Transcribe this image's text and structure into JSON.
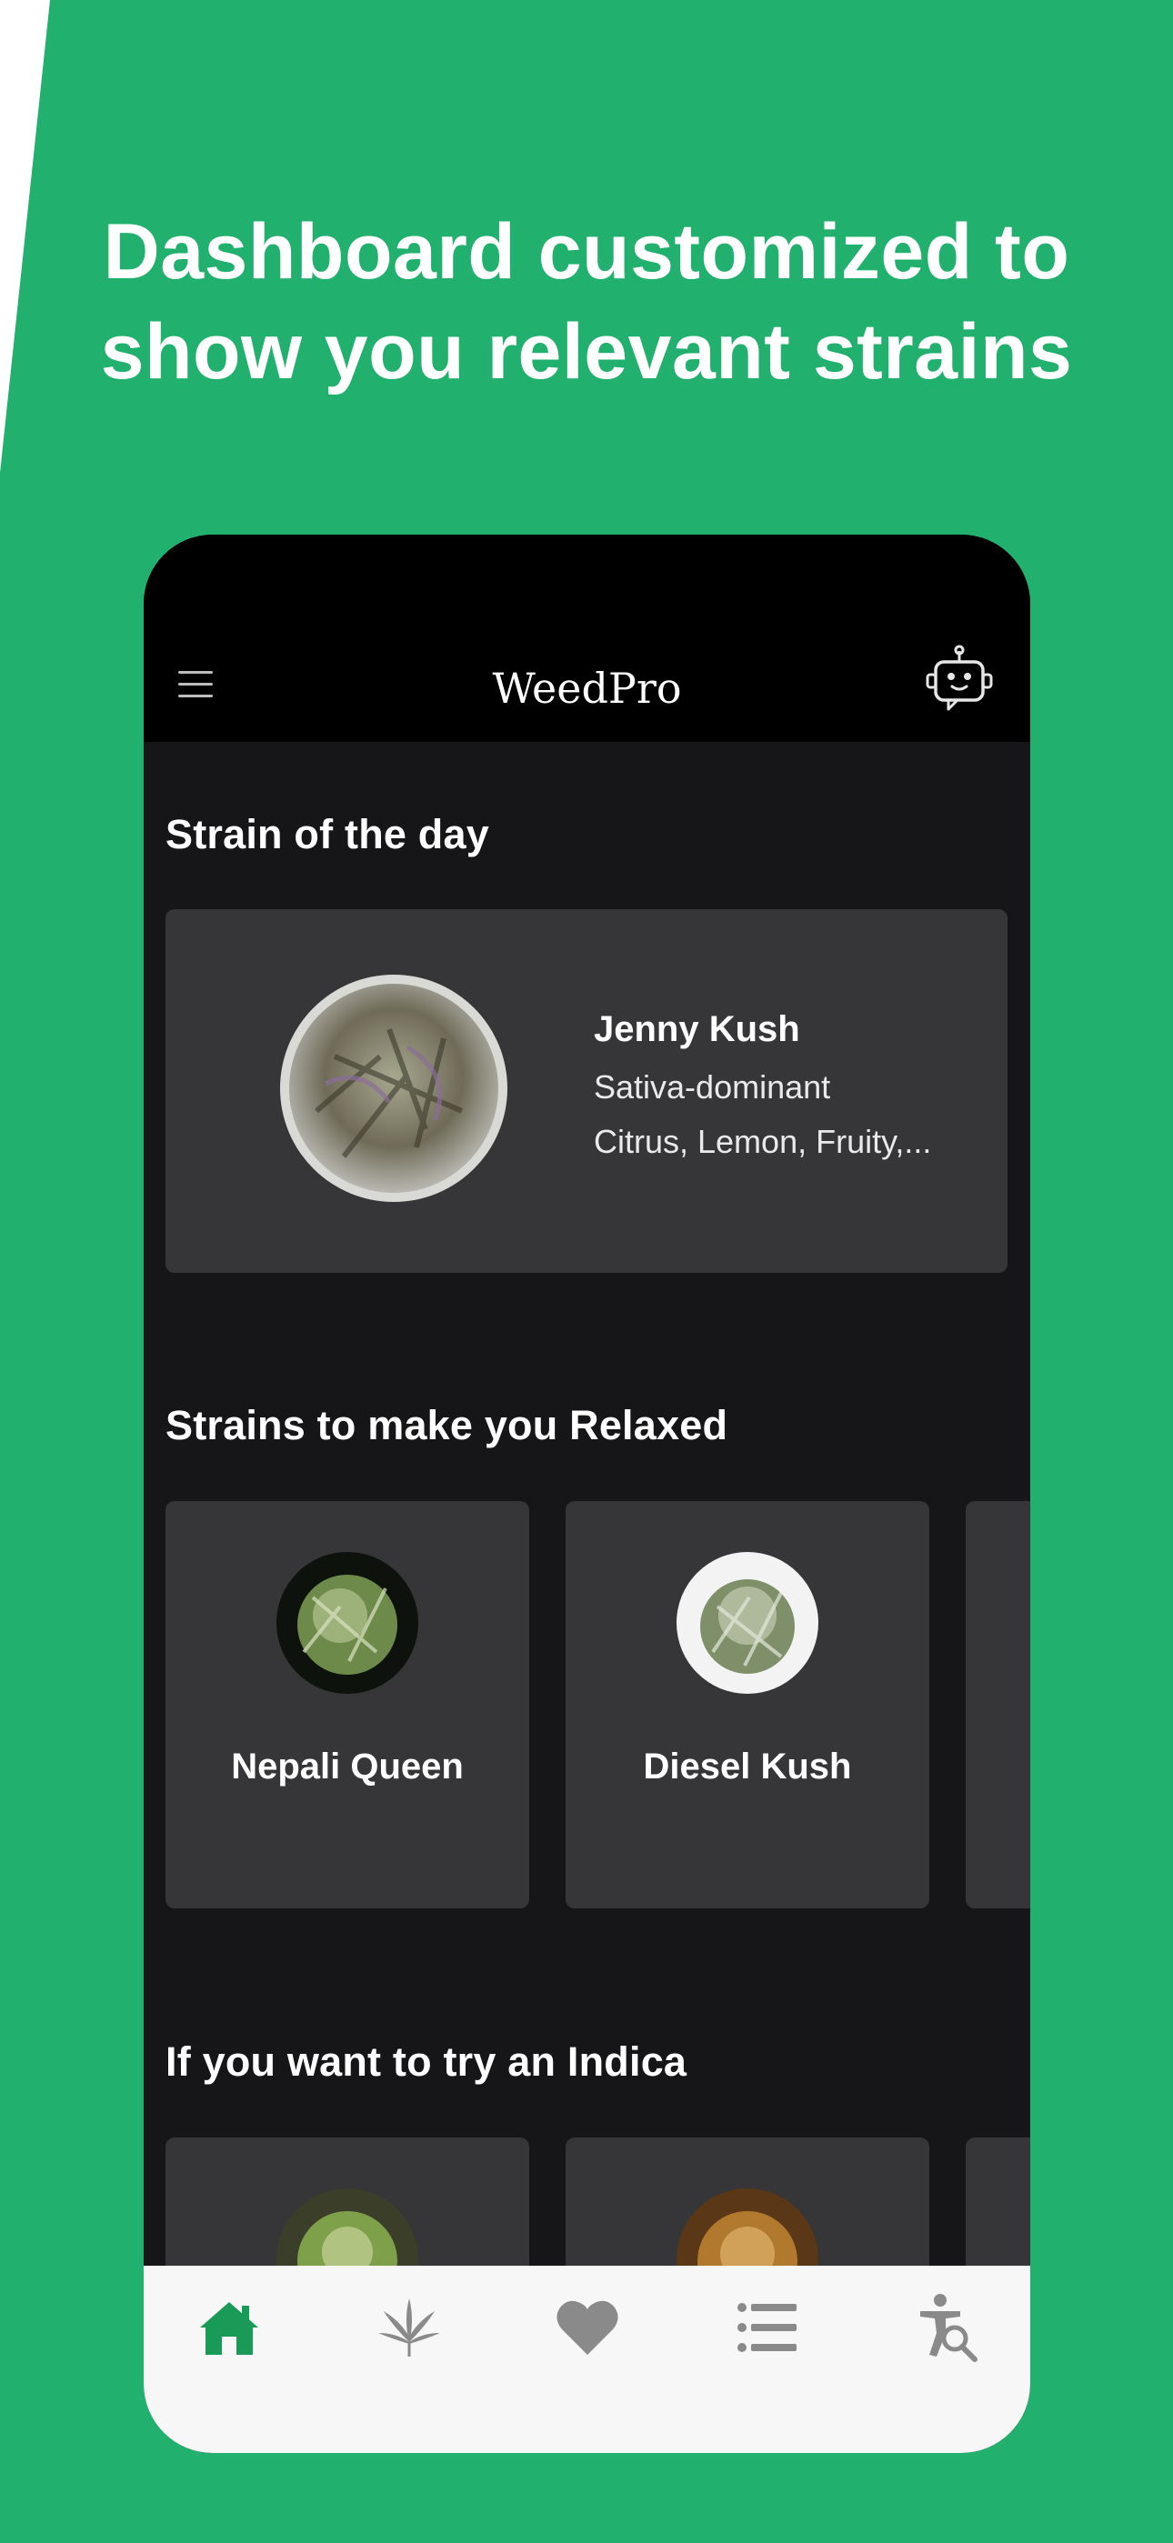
{
  "headline": {
    "line1": "Dashboard customized to",
    "line2": "show you relevant strains"
  },
  "app": {
    "title": "WeedPro",
    "menu_icon": "hamburger-menu-icon",
    "assistant_icon": "robot-assistant-icon"
  },
  "strain_of_the_day": {
    "section_title": "Strain of the day",
    "name": "Jenny Kush",
    "type": "Sativa-dominant",
    "flavors": "Citrus, Lemon, Fruity,..."
  },
  "relaxed": {
    "section_title": "Strains to make you Relaxed",
    "items": [
      {
        "name": "Nepali Queen",
        "image": "strain-photo-dark"
      },
      {
        "name": "Diesel Kush",
        "image": "strain-photo-light"
      }
    ]
  },
  "indica": {
    "section_title": "If you want to try an Indica"
  },
  "tabbar": {
    "active_color": "#1a9a57",
    "inactive_color": "#8a8a8a",
    "tabs": [
      "home-icon",
      "cannabis-leaf-icon",
      "heart-icon",
      "list-icon",
      "accessibility-search-icon"
    ]
  },
  "colors": {
    "background": "#22b06e",
    "card": "#363537",
    "screen": "#161517"
  }
}
